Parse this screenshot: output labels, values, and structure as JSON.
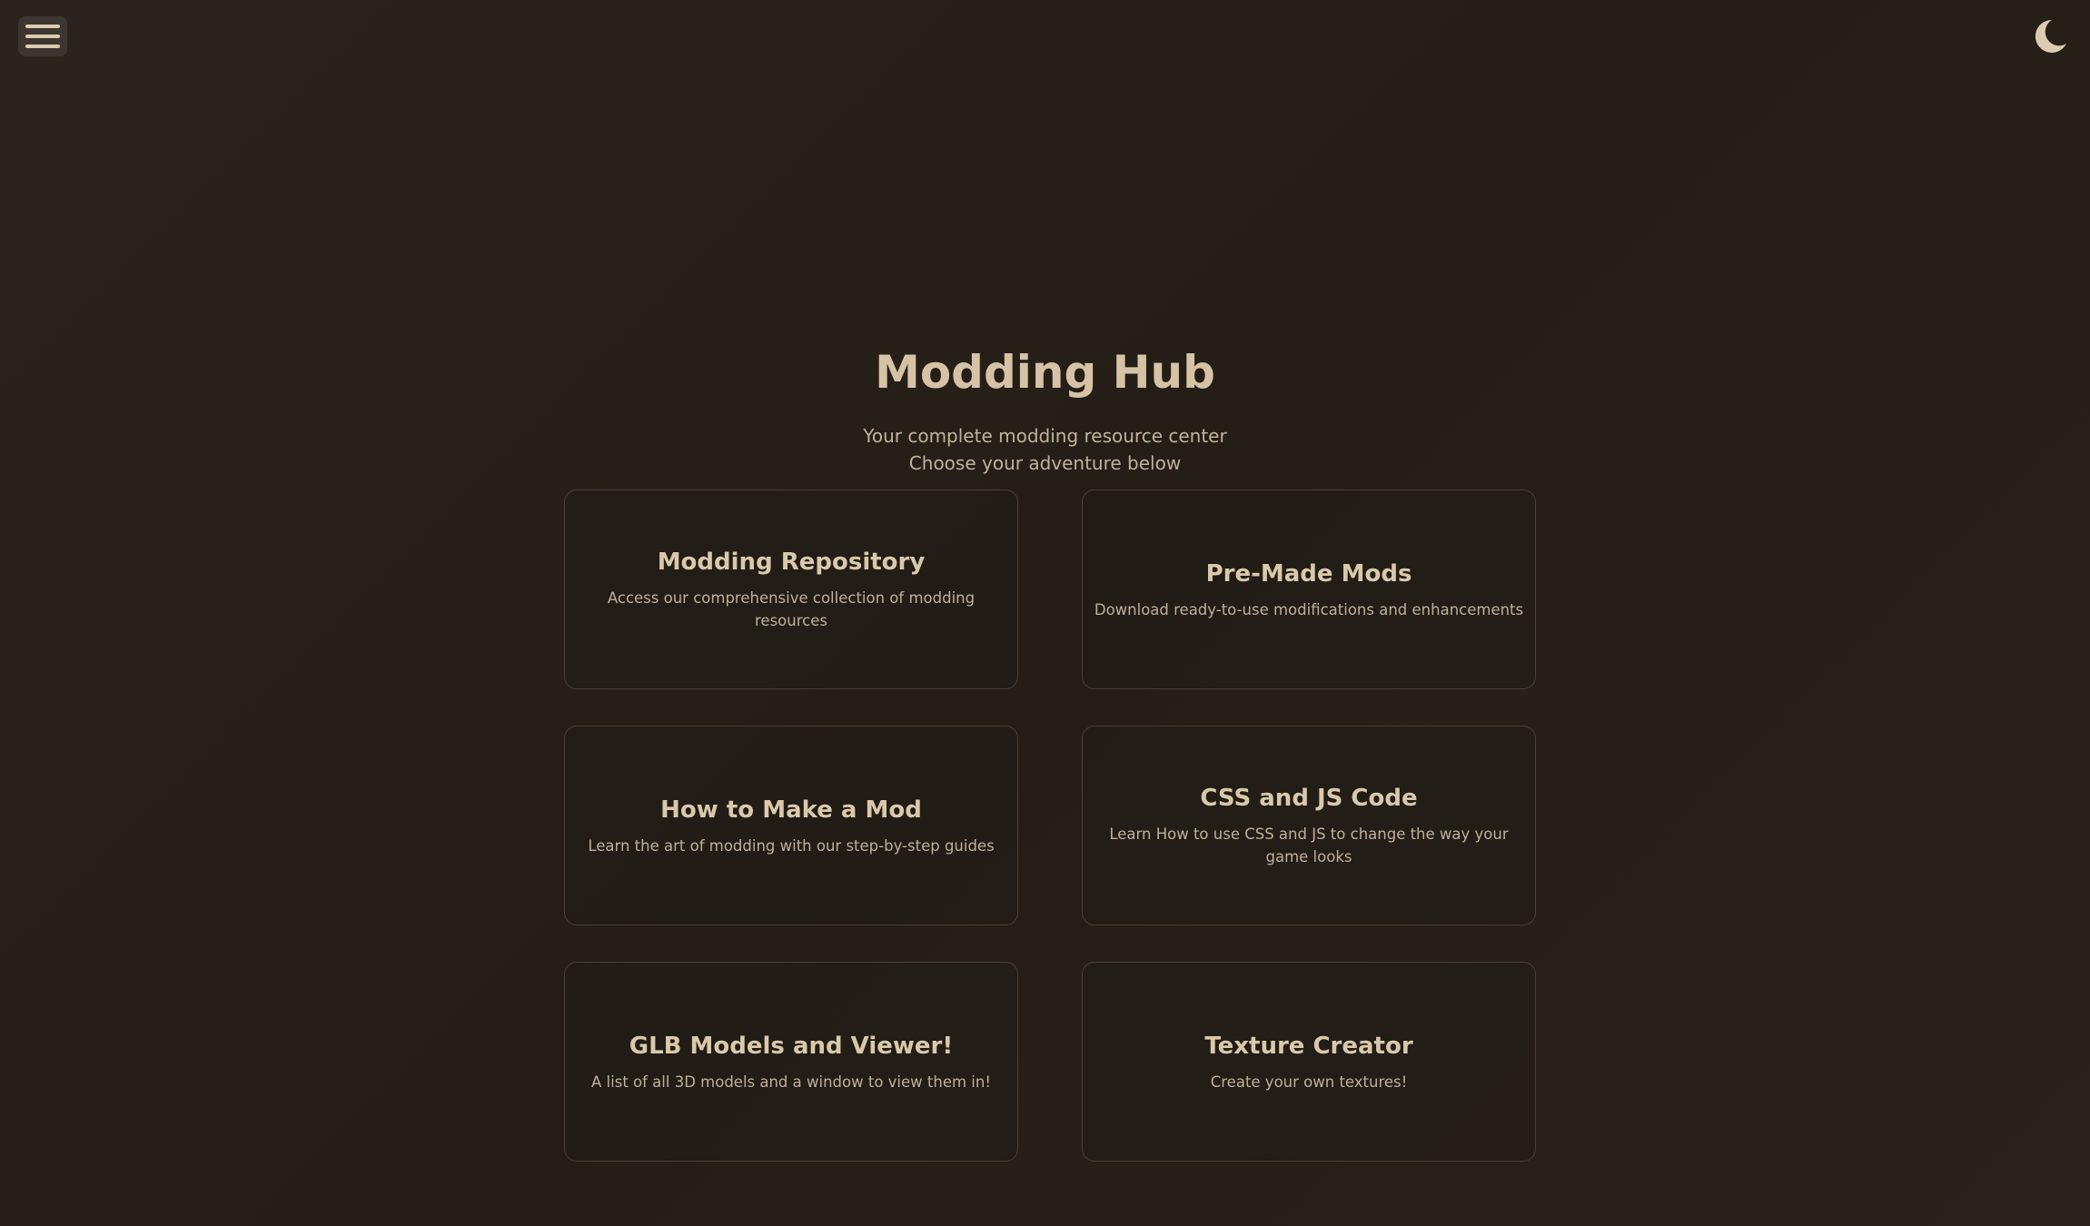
{
  "header": {
    "menu_icon": "hamburger-menu-icon",
    "theme_icon": "moon-icon"
  },
  "hero": {
    "title": "Modding Hub",
    "subtitle_line1": "Your complete modding resource center",
    "subtitle_line2": "Choose your adventure below"
  },
  "cards": [
    {
      "title": "Modding Repository",
      "description": "Access our comprehensive collection of modding resources"
    },
    {
      "title": "Pre-Made Mods",
      "description": "Download ready-to-use modifications and enhancements"
    },
    {
      "title": "How to Make a Mod",
      "description": "Learn the art of modding with our step-by-step guides"
    },
    {
      "title": "CSS and JS Code",
      "description": "Learn How to use CSS and JS to change the way your game looks"
    },
    {
      "title": "GLB Models and Viewer!",
      "description": "A list of all 3D models and a window to view them in!"
    },
    {
      "title": "Texture Creator",
      "description": "Create your own textures!"
    }
  ],
  "colors": {
    "background": "#272019",
    "accent": "#dccbb0",
    "card_border": "#4a4036"
  }
}
